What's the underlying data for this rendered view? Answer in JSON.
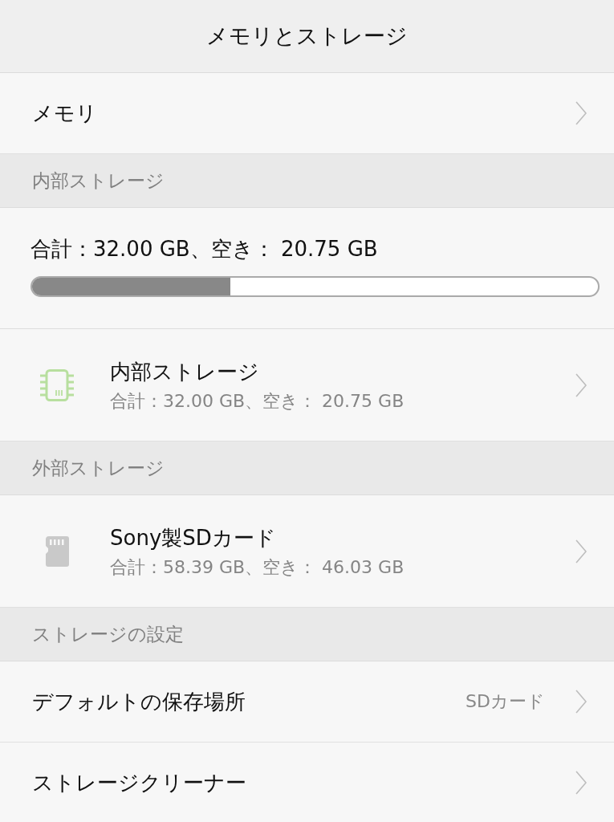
{
  "title_bar": {
    "title": "メモリとストレージ"
  },
  "items": [
    {
      "kind": "link",
      "label": "メモリ"
    },
    {
      "kind": "header",
      "label": "内部ストレージ"
    },
    {
      "kind": "usage",
      "summary": "合計：32.00 GB、空き： 20.75 GB",
      "level": 0.35
    },
    {
      "kind": "internal",
      "label": "内部ストレージ",
      "detail": "合計：32.00 GB、空き： 20.75 GB"
    },
    {
      "kind": "header",
      "label": "外部ストレージ"
    },
    {
      "kind": "sdcard",
      "label": "Sony製SDカード",
      "detail": "合計：58.39 GB、空き： 46.03 GB"
    },
    {
      "kind": "header",
      "label": "ストレージの設定"
    },
    {
      "kind": "link",
      "label": "デフォルトの保存場所",
      "value": "SDカード"
    },
    {
      "kind": "link",
      "label": "ストレージクリーナー"
    }
  ]
}
